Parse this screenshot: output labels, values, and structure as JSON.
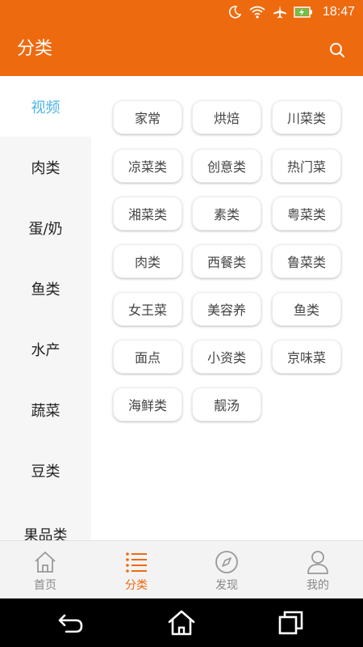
{
  "status_bar": {
    "time": "18:47"
  },
  "app_bar": {
    "title": "分类"
  },
  "sidebar": {
    "items": [
      {
        "label": "视频",
        "active": true
      },
      {
        "label": "肉类"
      },
      {
        "label": "蛋/奶"
      },
      {
        "label": "鱼类"
      },
      {
        "label": "水产"
      },
      {
        "label": "蔬菜"
      },
      {
        "label": "豆类"
      },
      {
        "label": "果品类"
      }
    ]
  },
  "categories": [
    "家常",
    "烘焙",
    "川菜类",
    "凉菜类",
    "创意类",
    "热门菜",
    "湘菜类",
    "素类",
    "粤菜类",
    "肉类",
    "西餐类",
    "鲁菜类",
    "女王菜",
    "美容养",
    "鱼类",
    "面点",
    "小资类",
    "京味菜",
    "海鲜类",
    "靓汤"
  ],
  "bottom_nav": [
    {
      "label": "首页"
    },
    {
      "label": "分类",
      "active": true
    },
    {
      "label": "发现"
    },
    {
      "label": "我的"
    }
  ],
  "colors": {
    "accent": "#ee6a0f",
    "active_sidebar_text": "#4db6e8"
  }
}
